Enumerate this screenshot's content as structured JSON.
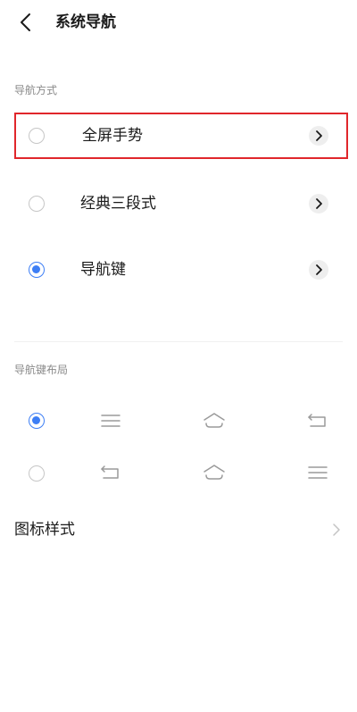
{
  "header": {
    "title": "系统导航",
    "back_icon": "chevron-left-icon"
  },
  "nav_mode": {
    "section_label": "导航方式",
    "options": [
      {
        "label": "全屏手势",
        "selected": false,
        "highlighted": true
      },
      {
        "label": "经典三段式",
        "selected": false,
        "highlighted": false
      },
      {
        "label": "导航键",
        "selected": true,
        "highlighted": false
      }
    ]
  },
  "nav_key_layout": {
    "section_label": "导航键布局",
    "rows": [
      {
        "selected": true,
        "icons": [
          "menu-icon",
          "home-icon",
          "back-icon"
        ]
      },
      {
        "selected": false,
        "icons": [
          "back-icon",
          "home-icon",
          "menu-icon"
        ]
      }
    ]
  },
  "icon_style": {
    "label": "图标样式"
  },
  "colors": {
    "accent": "#3d7ef5",
    "highlight_border": "#e0262b",
    "section_label": "#8a8a8a",
    "icon_gray": "#9a9a9a"
  }
}
